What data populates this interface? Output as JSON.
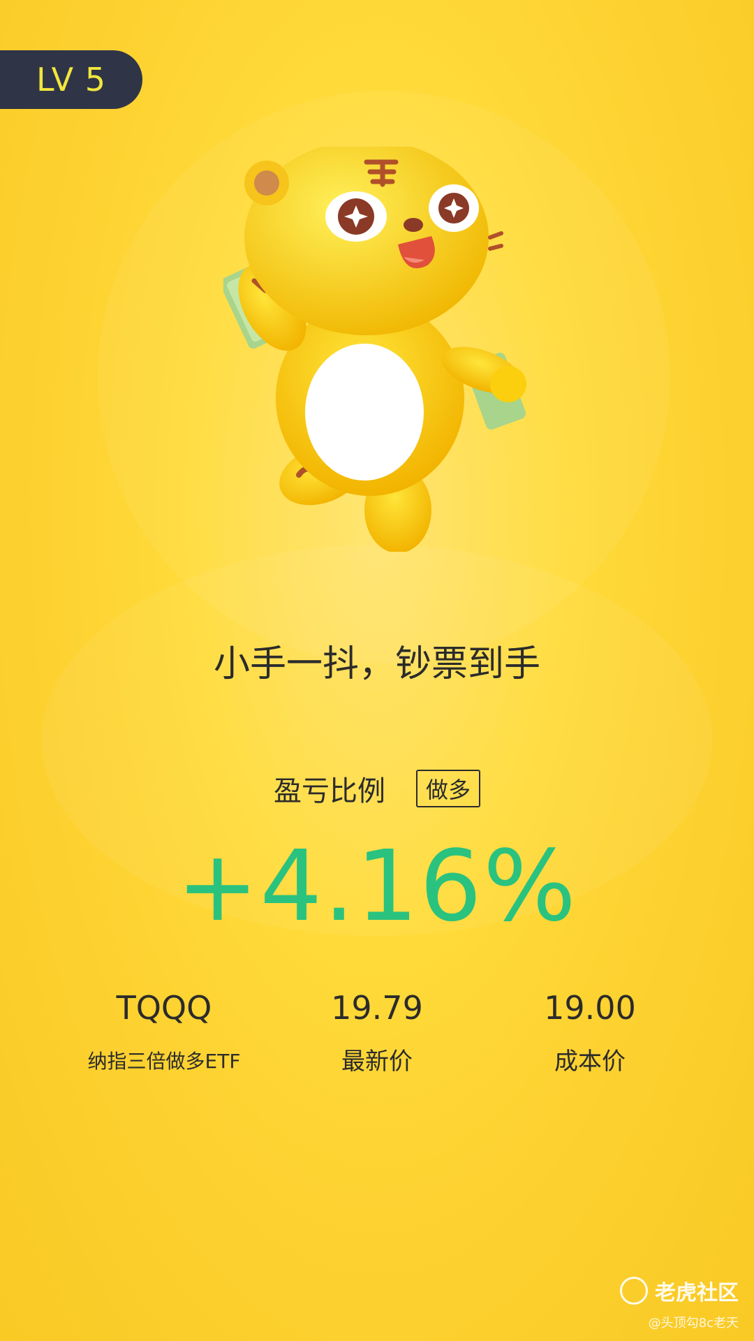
{
  "level": {
    "label": "LV 5"
  },
  "slogan": "小手一抖，钞票到手",
  "ratio": {
    "label": "盈亏比例",
    "direction": "做多",
    "value": "+4.16%",
    "color": "#2ac27f"
  },
  "stock": {
    "ticker": "TQQQ",
    "name": "纳指三倍做多ETF"
  },
  "latest": {
    "value": "19.79",
    "label": "最新价"
  },
  "cost": {
    "value": "19.00",
    "label": "成本价"
  },
  "watermark": {
    "brand": "老虎社区",
    "credit": "@头顶勾8c老天"
  },
  "colors": {
    "background": "#fdd231",
    "badge": "#2f3547",
    "badge_text": "#f3e63d",
    "gain": "#2ac27f"
  }
}
